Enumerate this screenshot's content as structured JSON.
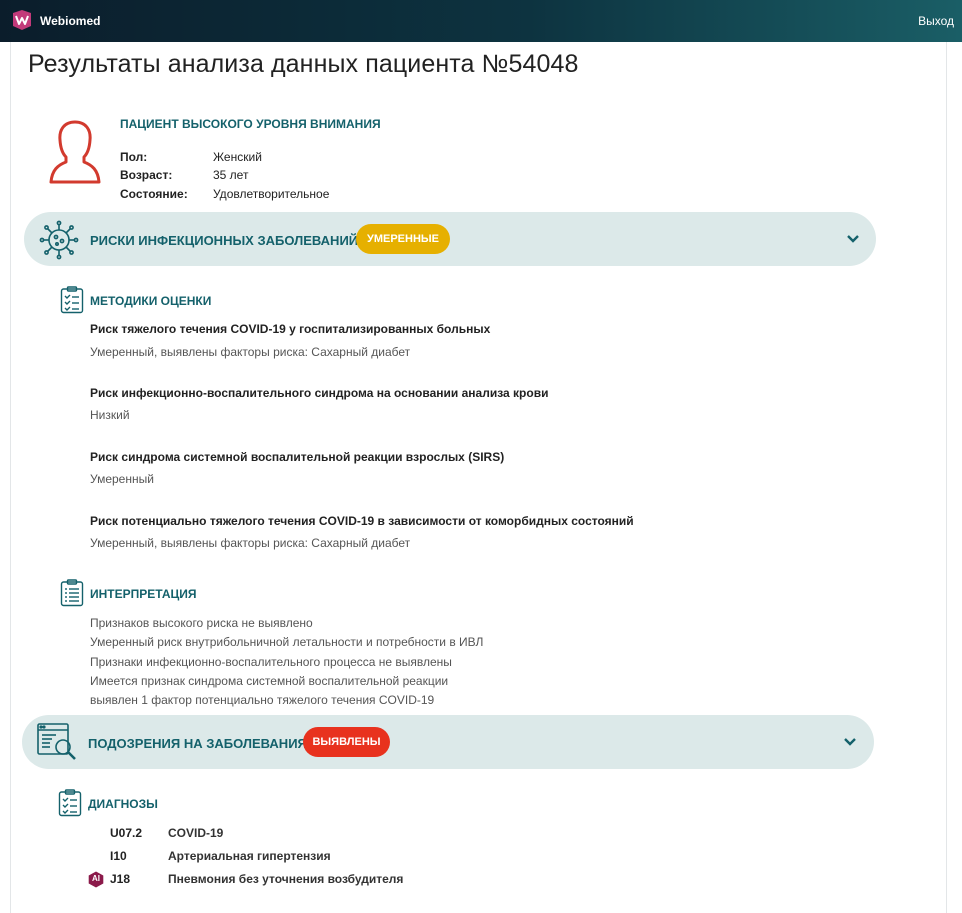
{
  "header": {
    "brand": "Webiomed",
    "logout": "Выход"
  },
  "page_title": "Результаты анализа данных пациента №54048",
  "patient": {
    "status": "ПАЦИЕНТ ВЫСОКОГО УРОВНЯ ВНИМАНИЯ",
    "fields": [
      {
        "key": "Пол:",
        "value": "Женский"
      },
      {
        "key": "Возраст:",
        "value": "35 лет"
      },
      {
        "key": "Состояние:",
        "value": "Удовлетворительное"
      }
    ]
  },
  "infection_risks": {
    "title": "РИСКИ ИНФЕКЦИОННЫХ ЗАБОЛЕВАНИЙ:",
    "badge": "УМЕРЕННЫЕ",
    "badge_color": "#e6b000"
  },
  "methods": {
    "title": "МЕТОДИКИ ОЦЕНКИ",
    "items": [
      {
        "title": "Риск тяжелого течения COVID-19 у госпитализированных больных",
        "value": "Умеренный, выявлены факторы риска: Сахарный диабет"
      },
      {
        "title": "Риск инфекционно-воспалительного синдрома на основании анализа крови",
        "value": "Низкий"
      },
      {
        "title": "Риск синдрома системной воспалительной реакции взрослых (SIRS)",
        "value": "Умеренный"
      },
      {
        "title": "Риск потенциально тяжелого течения COVID-19 в зависимости от коморбидных состояний",
        "value": "Умеренный, выявлены факторы риска: Сахарный диабет"
      }
    ]
  },
  "interpretation": {
    "title": "ИНТЕРПРЕТАЦИЯ",
    "lines": [
      "Признаков высокого риска не выявлено",
      "Умеренный риск внутрибольничной летальности и потребности в ИВЛ",
      "Признаки инфекционно-воспалительного процесса не выявлены",
      "Имеется признак синдрома системной воспалительной реакции",
      "выявлен 1 фактор потенциально тяжелого течения COVID-19"
    ]
  },
  "disease_suspicion": {
    "title": "ПОДОЗРЕНИЯ НА ЗАБОЛЕВАНИЯ:",
    "badge": "ВЫЯВЛЕНЫ",
    "badge_color": "#e8321e"
  },
  "diagnoses": {
    "title": "ДИАГНОЗЫ",
    "items": [
      {
        "code": "U07.2",
        "name": "COVID-19",
        "ai": false
      },
      {
        "code": "I10",
        "name": "Артериальная гипертензия",
        "ai": false
      },
      {
        "code": "J18",
        "name": "Пневмония без уточнения возбудителя",
        "ai": true,
        "ai_label": "AI"
      }
    ]
  },
  "colors": {
    "teal": "#14616b",
    "band_bg": "#dce9e9",
    "patient_icon": "#d23a2e"
  }
}
